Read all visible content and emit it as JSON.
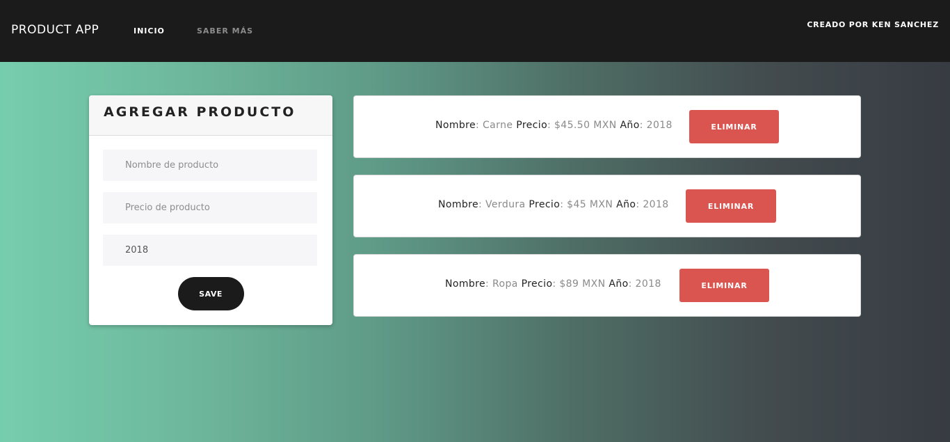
{
  "nav": {
    "brand": "PRODUCT APP",
    "links": [
      "INICIO",
      "SABER MÁS"
    ],
    "credit": "CREADO POR KEN SANCHEZ"
  },
  "form": {
    "title": "AGREGAR PRODUCTO",
    "name_placeholder": "Nombre de producto",
    "price_placeholder": "Precio de producto",
    "year_value": "2018",
    "save_label": "SAVE"
  },
  "labels": {
    "name": "Nombre",
    "price": "Precio",
    "year": "Año",
    "separator": ": "
  },
  "products": [
    {
      "name": "Carne",
      "price": "$45.50 MXN",
      "year": "2018",
      "delete_label": "ELIMINAR"
    },
    {
      "name": "Verdura",
      "price": "$45 MXN",
      "year": "2018",
      "delete_label": "ELIMINAR"
    },
    {
      "name": "Ropa",
      "price": "$89 MXN",
      "year": "2018",
      "delete_label": "ELIMINAR"
    }
  ],
  "colors": {
    "navbar": "#1b1b1b",
    "delete_button": "#da5450",
    "save_button": "#1b1b1b",
    "gradient_start": "#76cdae",
    "gradient_end": "#373b42"
  }
}
